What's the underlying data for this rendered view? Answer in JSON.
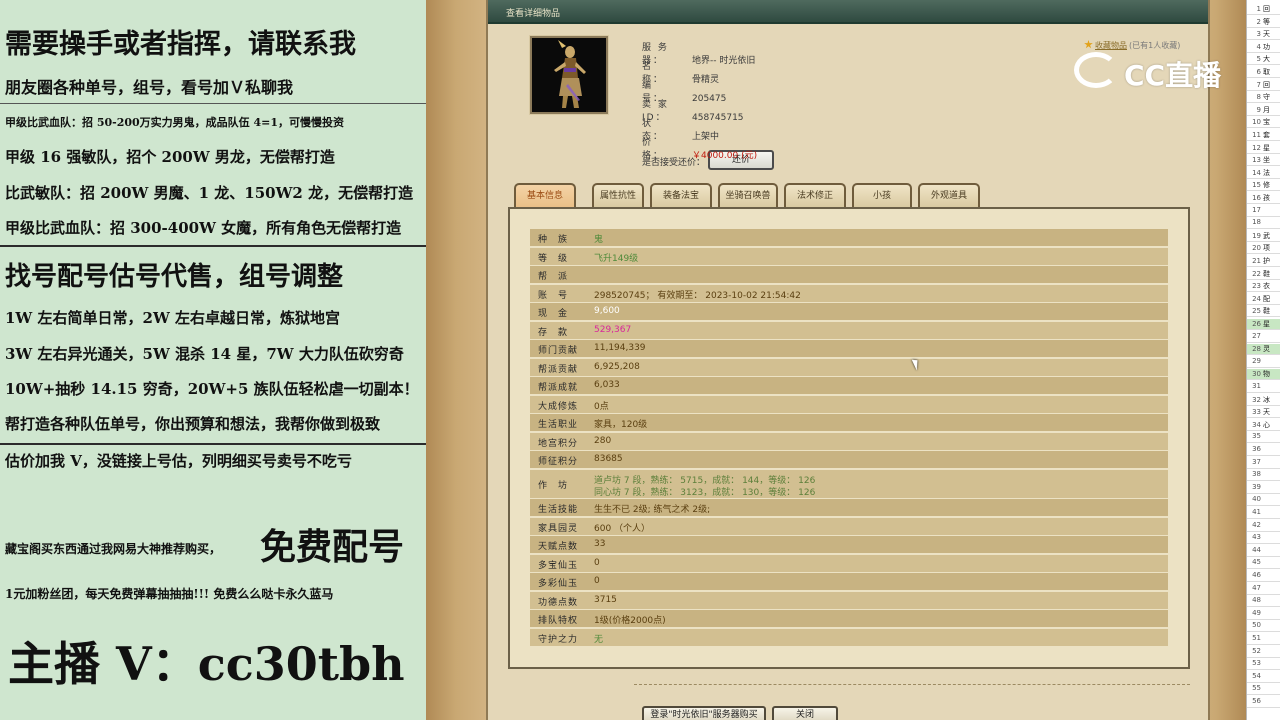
{
  "overlay": {
    "lines": [
      {
        "text": "需要操手或者指挥，请联系我",
        "size": 27
      },
      {
        "text": "朋友圈各种单号，组号，看号加Ｖ私聊我",
        "size": 16
      },
      {
        "text": "甲级比武血队：招 50-200万实力男鬼，成品队伍 4=1，可慢慢投资",
        "size": 11
      },
      {
        "text": "甲级 16 强敏队，招个 200W 男龙，无偿帮打造",
        "size": 15
      },
      {
        "text": "比武敏队：招 200W 男魔、1 龙、150W2 龙，无偿帮打造",
        "size": 15
      },
      {
        "text": "甲级比武血队：招 300-400W 女魔，所有角色无偿帮打造",
        "size": 15
      },
      {
        "text": "找号配号估号代售，组号调整",
        "size": 26
      },
      {
        "text": "1W 左右简单日常，2W 左右卓越日常，炼狱地宫",
        "size": 15
      },
      {
        "text": "3W 左右异光通关，5W 混杀 14 星，7W 大力队伍砍穷奇",
        "size": 15
      },
      {
        "text": "10W+抽秒 14.15 穷奇，20W+5 族队伍轻松虐一切副本！",
        "size": 15
      },
      {
        "text": "帮打造各种队伍单号，你出预算和想法，我帮你做到极致",
        "size": 15
      },
      {
        "text": "估价加我 V，没链接上号估，列明细买号卖号不吃亏",
        "size": 15
      },
      {
        "text": "藏宝阁买东西通过我网易大神推荐购买，",
        "size": 12
      },
      {
        "text": "免费配号",
        "size": 36
      },
      {
        "text": "1元加粉丝团，每天免费弹幕抽抽抽!!! 免费么么哒卡永久蓝马",
        "size": 12
      },
      {
        "text": "主播 V：cc30tbh",
        "size": 46
      }
    ]
  },
  "dialog": {
    "title": "查看详细物品",
    "favorite": {
      "label": "收藏物品",
      "count": "(已有1人收藏)"
    },
    "info": [
      {
        "label": "服 务 器：",
        "value": "地界-- 时光依旧"
      },
      {
        "label": "名　　称：",
        "value": "骨精灵"
      },
      {
        "label": "编　　号：",
        "value": "205475"
      },
      {
        "label": "卖 家 ID：",
        "value": "458745715"
      },
      {
        "label": "状　　态：",
        "value": "上架中"
      },
      {
        "label": "价　　格：",
        "value": "￥4000.00 (元)"
      }
    ],
    "haggle": {
      "label": "是否接受还价：",
      "button": "还价"
    },
    "tabs": [
      "基本信息",
      "属性抗性",
      "装备法宝",
      "坐骑召唤兽",
      "法术修正",
      "小孩",
      "外观道具"
    ],
    "active_tab": 0,
    "rows": [
      {
        "label": "种　族",
        "value": "鬼",
        "style": "green"
      },
      {
        "label": "等　级",
        "value": "飞升149级",
        "style": "green"
      },
      {
        "label": "帮　派",
        "value": "",
        "style": ""
      },
      {
        "label": "账　号",
        "value": "298520745； 有效期至： 2023-10-02 21:54:42",
        "style": ""
      },
      {
        "label": "现　金",
        "value": "9,600",
        "style": "white"
      },
      {
        "label": "存　款",
        "value": "529,367",
        "style": "pink"
      },
      {
        "label": "师门贡献",
        "value": "11,194,339",
        "style": ""
      },
      {
        "label": "帮派贡献",
        "value": "6,925,208",
        "style": ""
      },
      {
        "label": "帮派成就",
        "value": "6,033",
        "style": ""
      },
      {
        "label": "大成修炼",
        "value": "0点",
        "style": ""
      },
      {
        "label": "生活职业",
        "value": "家具，120级",
        "style": ""
      },
      {
        "label": "地宫积分",
        "value": "280",
        "style": ""
      },
      {
        "label": "师征积分",
        "value": "83685",
        "style": ""
      },
      {
        "label": "作　坊",
        "value": "道卢坊 7 段，熟练： 5715，成就： 144，等级： 126",
        "value2": "同心坊 7 段，熟练： 3123，成就： 130，等级： 126",
        "style": ""
      },
      {
        "label": "生活技能",
        "value": "生生不已 2级; 练气之术 2级;",
        "style": ""
      },
      {
        "label": "家具园灵",
        "value": "600 （个人）",
        "style": ""
      },
      {
        "label": "天赋点数",
        "value": "33",
        "style": ""
      },
      {
        "label": "多宝仙玉",
        "value": "0",
        "style": ""
      },
      {
        "label": "多彩仙玉",
        "value": "0",
        "style": ""
      },
      {
        "label": "功德点数",
        "value": "3715",
        "style": ""
      },
      {
        "label": "排队特权",
        "value": "1级(价格2000点)",
        "style": ""
      },
      {
        "label": "守护之力",
        "value": "无",
        "style": "green"
      }
    ],
    "buttons": {
      "login": "登录\"时光依旧\"服务器购买",
      "close": "关闭"
    }
  },
  "watermark": {
    "text": "CC直播"
  },
  "spreadsheet": {
    "rows": [
      {
        "n": "1",
        "t": "回"
      },
      {
        "n": "2",
        "t": "等"
      },
      {
        "n": "3",
        "t": "天"
      },
      {
        "n": "4",
        "t": "功"
      },
      {
        "n": "5",
        "t": "大"
      },
      {
        "n": "6",
        "t": "取"
      },
      {
        "n": "7",
        "t": "回"
      },
      {
        "n": "8",
        "t": "守"
      },
      {
        "n": "9",
        "t": "月"
      },
      {
        "n": "10",
        "t": "宝"
      },
      {
        "n": "11",
        "t": "套"
      },
      {
        "n": "12",
        "t": "星"
      },
      {
        "n": "13",
        "t": "坐"
      },
      {
        "n": "14",
        "t": "法"
      },
      {
        "n": "15",
        "t": "修"
      },
      {
        "n": "16",
        "t": "孩"
      },
      {
        "n": "17",
        "t": ""
      },
      {
        "n": "18",
        "t": ""
      },
      {
        "n": "19",
        "t": "武"
      },
      {
        "n": "20",
        "t": "项"
      },
      {
        "n": "21",
        "t": "护"
      },
      {
        "n": "22",
        "t": "鞋"
      },
      {
        "n": "23",
        "t": "衣"
      },
      {
        "n": "24",
        "t": "配"
      },
      {
        "n": "25",
        "t": "鞋"
      },
      {
        "n": "26",
        "t": "星",
        "hl": true
      },
      {
        "n": "27",
        "t": ""
      },
      {
        "n": "28",
        "t": "灵",
        "hl": true
      },
      {
        "n": "29",
        "t": ""
      },
      {
        "n": "30",
        "t": "物",
        "hl": true
      },
      {
        "n": "31",
        "t": ""
      },
      {
        "n": "32",
        "t": "冰"
      },
      {
        "n": "33",
        "t": "天"
      },
      {
        "n": "34",
        "t": "心"
      },
      {
        "n": "35",
        "t": ""
      },
      {
        "n": "36",
        "t": ""
      },
      {
        "n": "37",
        "t": ""
      },
      {
        "n": "38",
        "t": ""
      },
      {
        "n": "39",
        "t": ""
      },
      {
        "n": "40",
        "t": ""
      },
      {
        "n": "41",
        "t": ""
      },
      {
        "n": "42",
        "t": ""
      },
      {
        "n": "43",
        "t": ""
      },
      {
        "n": "44",
        "t": ""
      },
      {
        "n": "45",
        "t": ""
      },
      {
        "n": "46",
        "t": ""
      },
      {
        "n": "47",
        "t": ""
      },
      {
        "n": "48",
        "t": ""
      },
      {
        "n": "49",
        "t": ""
      },
      {
        "n": "50",
        "t": ""
      },
      {
        "n": "51",
        "t": ""
      },
      {
        "n": "52",
        "t": ""
      },
      {
        "n": "53",
        "t": ""
      },
      {
        "n": "54",
        "t": ""
      },
      {
        "n": "55",
        "t": ""
      },
      {
        "n": "56",
        "t": ""
      }
    ]
  }
}
